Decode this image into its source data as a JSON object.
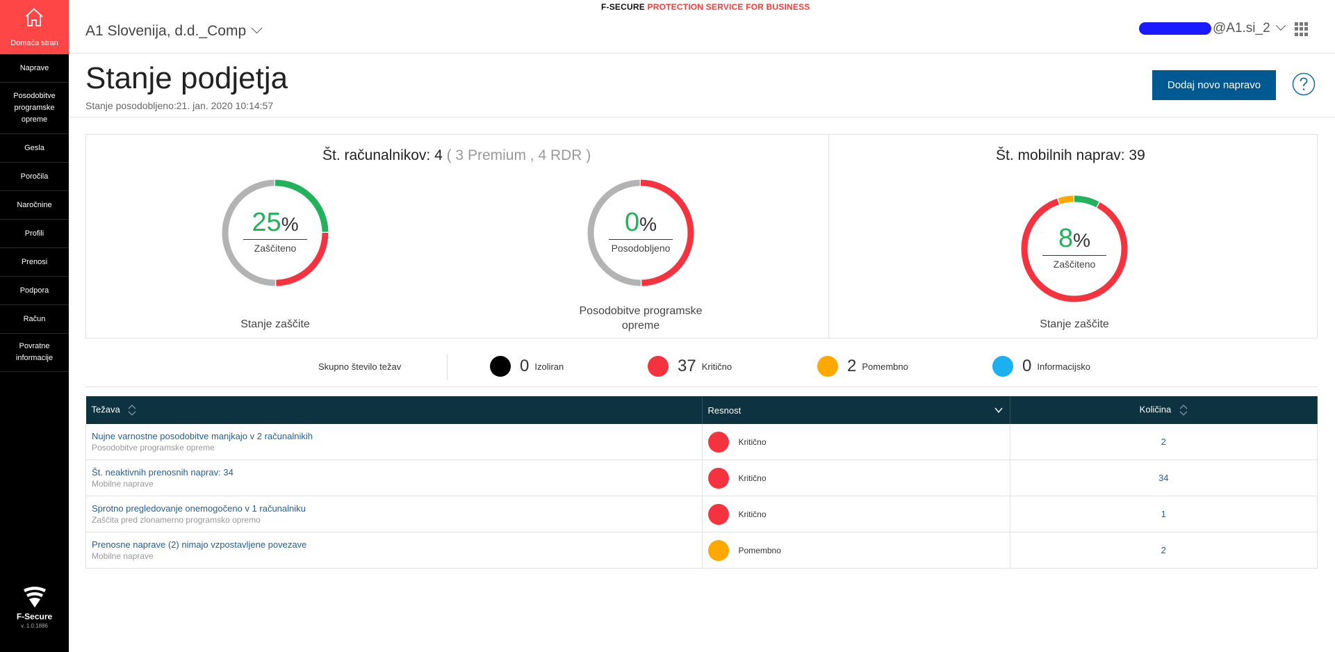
{
  "colors": {
    "accent": "#ff4646",
    "primary_button": "#005a91",
    "table_header": "#0d3340",
    "green": "#21b25b",
    "red": "#f5333f",
    "orange": "#ffa800",
    "grey": "#b3b3b3",
    "black": "#000000",
    "blue": "#1bb1f1"
  },
  "sidebar": {
    "home_label": "Domača stran",
    "items": [
      {
        "label": "Naprave"
      },
      {
        "label": "Posodobitve programske opreme"
      },
      {
        "label": "Gesla"
      },
      {
        "label": "Poročila"
      },
      {
        "label": "Naročnine"
      },
      {
        "label": "Profili"
      },
      {
        "label": "Prenosi"
      },
      {
        "label": "Podpora"
      },
      {
        "label": "Račun"
      },
      {
        "label": "Povratne informacije"
      }
    ],
    "logo_text": "F-Secure",
    "version": "v. 1.0.1886"
  },
  "topbar": {
    "brand_part1": "F-SECURE",
    "brand_part2": "PROTECTION SERVICE FOR BUSINESS",
    "company": "A1 Slovenija, d.d._Comp",
    "user_suffix": "@A1.si_2"
  },
  "header": {
    "title": "Stanje podjetja",
    "updated": "Stanje posodobljeno:21. jan. 2020 10:14:57",
    "add_button": "Dodaj novo napravo"
  },
  "computers": {
    "title_main": "Št. računalnikov: 4",
    "title_detail": "( 3 Premium , 4 RDR )",
    "protection": {
      "percent": "25",
      "label": "Zaščiteno",
      "caption": "Stanje zaščite",
      "segments": [
        {
          "color": "green",
          "value": 25
        },
        {
          "color": "red",
          "value": 25
        },
        {
          "color": "grey",
          "value": 50
        }
      ]
    },
    "updates": {
      "percent": "0",
      "label": "Posodobljeno",
      "caption": "Posodobitve programske opreme",
      "segments": [
        {
          "color": "red",
          "value": 50
        },
        {
          "color": "grey",
          "value": 50
        }
      ]
    }
  },
  "mobile": {
    "title": "Št. mobilnih naprav: 39",
    "protection": {
      "percent": "8",
      "label": "Zaščiteno",
      "caption": "Stanje zaščite",
      "segments": [
        {
          "color": "green",
          "value": 8
        },
        {
          "color": "red",
          "value": 87
        },
        {
          "color": "orange",
          "value": 5
        }
      ]
    }
  },
  "legend": {
    "total_label": "Skupno število težav",
    "items": [
      {
        "count": "0",
        "label": "Izoliran",
        "color": "black"
      },
      {
        "count": "37",
        "label": "Kritično",
        "color": "red"
      },
      {
        "count": "2",
        "label": "Pomembno",
        "color": "orange"
      },
      {
        "count": "0",
        "label": "Informacijsko",
        "color": "blue"
      }
    ]
  },
  "table": {
    "headers": {
      "issue": "Težava",
      "severity": "Resnost",
      "quantity": "Količina"
    },
    "rows": [
      {
        "title": "Nujne varnostne posodobitve manjkajo v 2 računalnikih",
        "category": "Posodobitve programske opreme",
        "severity": "Kritično",
        "severity_color": "red",
        "quantity": "2"
      },
      {
        "title": "Št. neaktivnih prenosnih naprav: 34",
        "category": "Mobilne naprave",
        "severity": "Kritično",
        "severity_color": "red",
        "quantity": "34"
      },
      {
        "title": "Sprotno pregledovanje onemogočeno v 1 računalniku",
        "category": "Zaščita pred zlonamerno programsko opremo",
        "severity": "Kritično",
        "severity_color": "red",
        "quantity": "1"
      },
      {
        "title": "Prenosne naprave (2) nimajo vzpostavljene povezave",
        "category": "Mobilne naprave",
        "severity": "Pomembno",
        "severity_color": "orange",
        "quantity": "2"
      }
    ]
  }
}
